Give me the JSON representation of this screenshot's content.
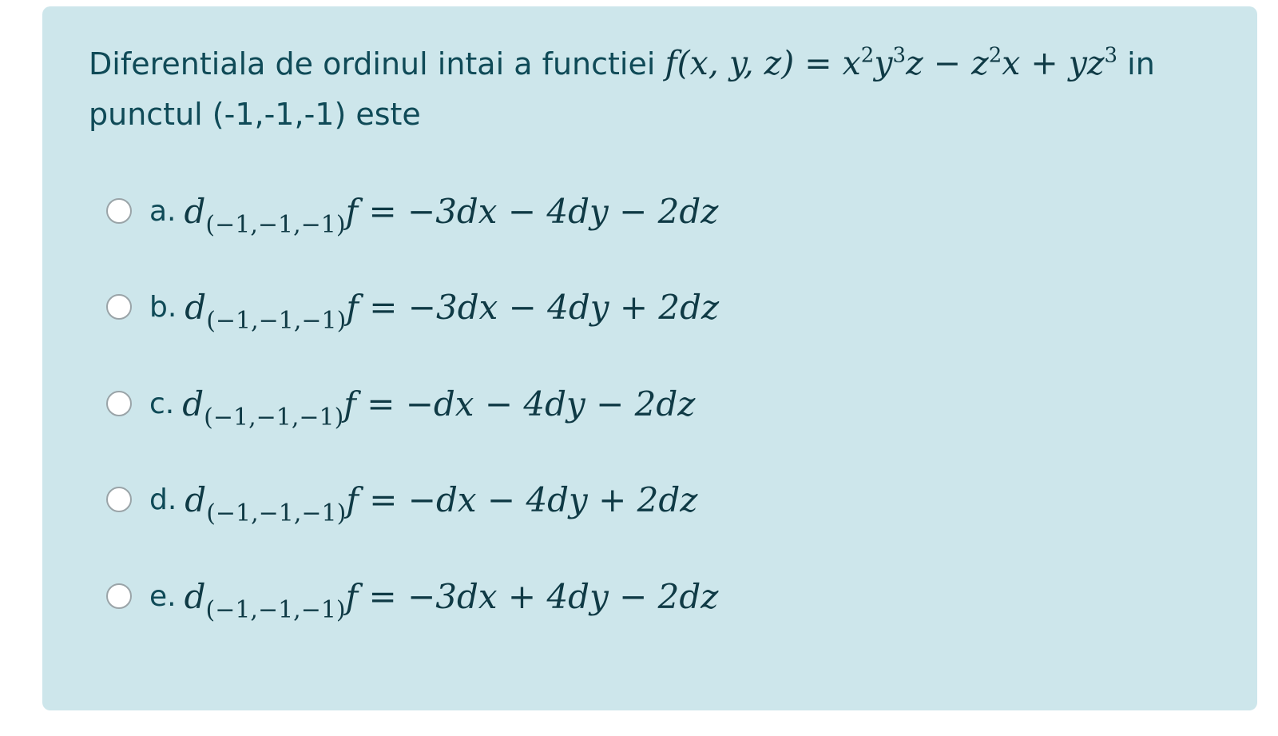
{
  "question": {
    "text_before": "Diferentiala de ordinul intai a functiei ",
    "function_lhs": "f(x, y, z) = ",
    "function_rhs": {
      "t1": "x",
      "t1_exp": "2",
      "t2": "y",
      "t2_exp": "3",
      "t3": "z − z",
      "t3_exp": "2",
      "t4": "x + yz",
      "t4_exp": "3"
    },
    "text_after": " in punctul (-1,-1,-1) este"
  },
  "options": [
    {
      "letter": "a.",
      "d": "d",
      "point": "(−1,−1,−1)",
      "rest": "f = −3dx − 4dy − 2dz"
    },
    {
      "letter": "b.",
      "d": "d",
      "point": "(−1,−1,−1)",
      "rest": "f = −3dx − 4dy + 2dz"
    },
    {
      "letter": "c.",
      "d": "d",
      "point": "(−1,−1,−1)",
      "rest": "f = −dx − 4dy − 2dz"
    },
    {
      "letter": "d.",
      "d": "d",
      "point": "(−1,−1,−1)",
      "rest": "f = −dx − 4dy + 2dz"
    },
    {
      "letter": "e.",
      "d": "d",
      "point": "(−1,−1,−1)",
      "rest": "f = −3dx + 4dy − 2dz"
    }
  ],
  "colors": {
    "card_background": "#cde6eb",
    "text": "#0f4a57",
    "radio_fill": "#ffffff",
    "radio_border": "#9aa4a8"
  }
}
